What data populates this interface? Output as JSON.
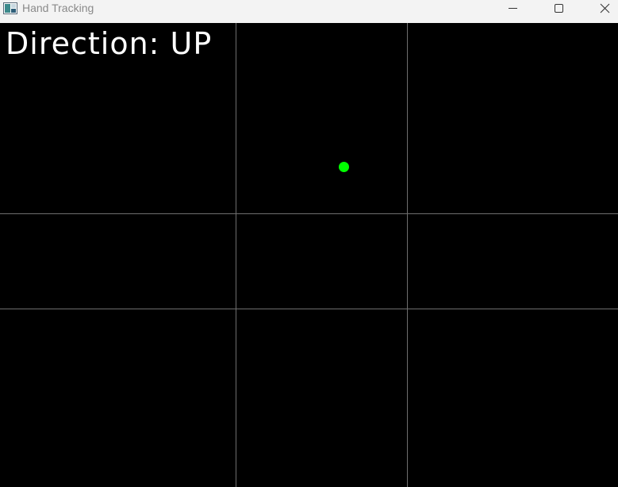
{
  "window": {
    "title": "Hand Tracking",
    "icons": {
      "app": "app-window-icon",
      "minimize": "minimize-icon",
      "maximize": "maximize-icon",
      "close": "close-icon"
    }
  },
  "overlay": {
    "direction_text": "Direction: UP",
    "tracking_point_color": "#00ff00",
    "grid_line_color": "#6e6e6e",
    "text_color": "#ffffff",
    "background_color": "#000000"
  }
}
